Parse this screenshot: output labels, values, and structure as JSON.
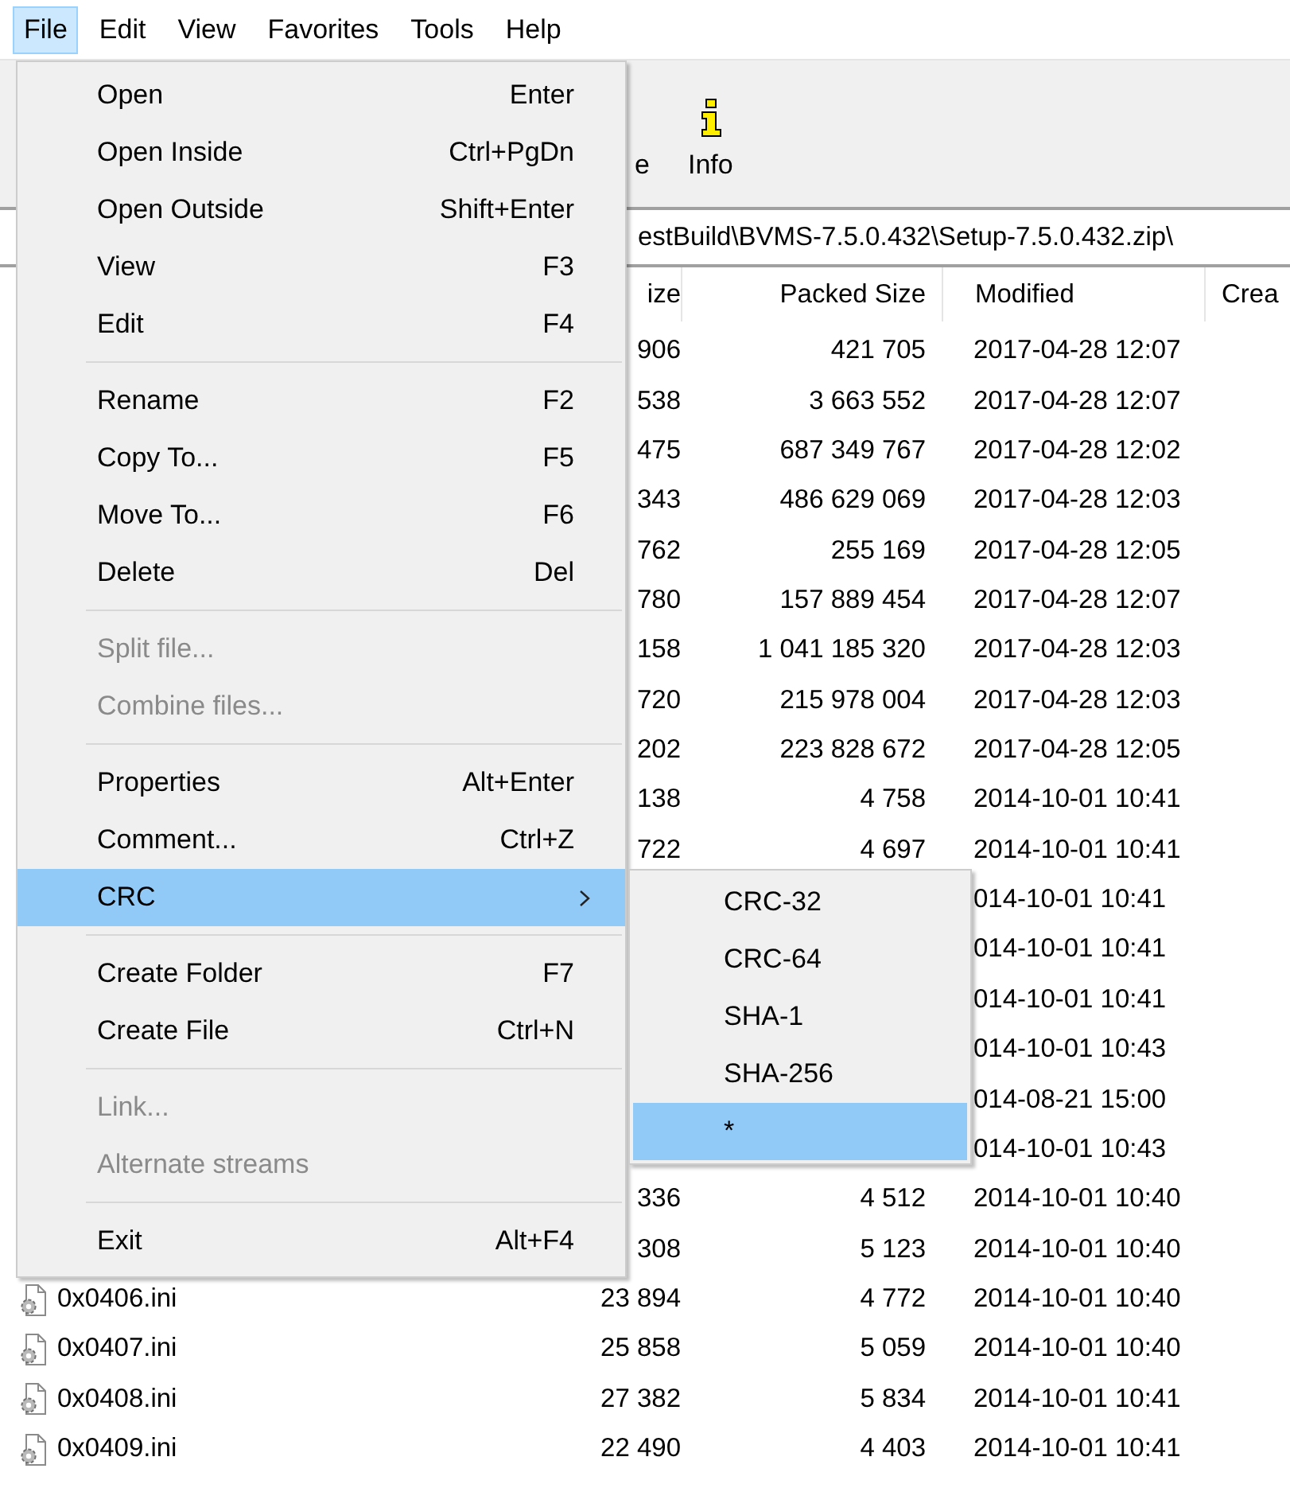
{
  "menubar": [
    {
      "label": "File",
      "selected": true
    },
    {
      "label": "Edit",
      "selected": false
    },
    {
      "label": "View",
      "selected": false
    },
    {
      "label": "Favorites",
      "selected": false
    },
    {
      "label": "Tools",
      "selected": false
    },
    {
      "label": "Help",
      "selected": false
    }
  ],
  "toolbar": [
    {
      "label": "e",
      "kind": "text"
    },
    {
      "label": "Info",
      "kind": "info"
    }
  ],
  "address": "estBuild\\BVMS-7.5.0.432\\Setup-7.5.0.432.zip\\",
  "table": {
    "columns": [
      "ize",
      "Packed Size",
      "Modified",
      "Crea"
    ],
    "rows": [
      {
        "size": "906",
        "packed_size": "421 705",
        "modified": "2017-04-28 12:07"
      },
      {
        "size": "538",
        "packed_size": "3 663 552",
        "modified": "2017-04-28 12:07"
      },
      {
        "size": "475",
        "packed_size": "687 349 767",
        "modified": "2017-04-28 12:02"
      },
      {
        "size": "343",
        "packed_size": "486 629 069",
        "modified": "2017-04-28 12:03"
      },
      {
        "size": "762",
        "packed_size": "255 169",
        "modified": "2017-04-28 12:05"
      },
      {
        "size": "780",
        "packed_size": "157 889 454",
        "modified": "2017-04-28 12:07"
      },
      {
        "size": "158",
        "packed_size": "1 041 185 320",
        "modified": "2017-04-28 12:03"
      },
      {
        "size": "720",
        "packed_size": "215 978 004",
        "modified": "2017-04-28 12:03"
      },
      {
        "size": "202",
        "packed_size": "223 828 672",
        "modified": "2017-04-28 12:05"
      },
      {
        "size": "138",
        "packed_size": "4 758",
        "modified": "2014-10-01 10:41"
      },
      {
        "size": "722",
        "packed_size": "4 697",
        "modified": "2014-10-01 10:41"
      },
      {
        "modified": "014-10-01 10:41"
      },
      {
        "modified": "014-10-01 10:41"
      },
      {
        "modified": "014-10-01 10:41"
      },
      {
        "modified": "014-10-01 10:43"
      },
      {
        "modified": "014-08-21 15:00"
      },
      {
        "modified": "014-10-01 10:43"
      },
      {
        "size": "336",
        "packed_size": "4 512",
        "modified": "2014-10-01 10:40"
      },
      {
        "size": "308",
        "packed_size": "5 123",
        "modified": "2014-10-01 10:40"
      },
      {
        "name": "0x0406.ini",
        "size": "23 894",
        "packed_size": "4 772",
        "modified": "2014-10-01 10:40"
      },
      {
        "name": "0x0407.ini",
        "size": "25 858",
        "packed_size": "5 059",
        "modified": "2014-10-01 10:40"
      },
      {
        "name": "0x0408.ini",
        "size": "27 382",
        "packed_size": "5 834",
        "modified": "2014-10-01 10:41"
      },
      {
        "name": "0x0409.ini",
        "size": "22 490",
        "packed_size": "4 403",
        "modified": "2014-10-01 10:41"
      }
    ]
  },
  "menu": {
    "groups": [
      {
        "items": [
          {
            "label": "Open",
            "shortcut": "Enter",
            "kind": "command",
            "disabled": false,
            "selected": false
          },
          {
            "label": "Open Inside",
            "shortcut": "Ctrl+PgDn",
            "kind": "command",
            "disabled": false,
            "selected": false
          },
          {
            "label": "Open Outside",
            "shortcut": "Shift+Enter",
            "kind": "command",
            "disabled": false,
            "selected": false
          },
          {
            "label": "View",
            "shortcut": "F3",
            "kind": "command",
            "disabled": false,
            "selected": false
          },
          {
            "label": "Edit",
            "shortcut": "F4",
            "kind": "command",
            "disabled": false,
            "selected": false
          }
        ]
      },
      {
        "items": [
          {
            "label": "Rename",
            "shortcut": "F2",
            "kind": "command",
            "disabled": false,
            "selected": false
          },
          {
            "label": "Copy To...",
            "shortcut": "F5",
            "kind": "command",
            "disabled": false,
            "selected": false
          },
          {
            "label": "Move To...",
            "shortcut": "F6",
            "kind": "command",
            "disabled": false,
            "selected": false
          },
          {
            "label": "Delete",
            "shortcut": "Del",
            "kind": "command",
            "disabled": false,
            "selected": false
          }
        ]
      },
      {
        "items": [
          {
            "label": "Split file...",
            "kind": "command",
            "disabled": true,
            "selected": false
          },
          {
            "label": "Combine files...",
            "kind": "command",
            "disabled": true,
            "selected": false
          }
        ]
      },
      {
        "items": [
          {
            "label": "Properties",
            "shortcut": "Alt+Enter",
            "kind": "command",
            "disabled": false,
            "selected": false
          },
          {
            "label": "Comment...",
            "shortcut": "Ctrl+Z",
            "kind": "command",
            "disabled": false,
            "selected": false
          },
          {
            "label": "CRC",
            "kind": "submenu",
            "disabled": false,
            "selected": true
          }
        ]
      },
      {
        "items": [
          {
            "label": "Create Folder",
            "shortcut": "F7",
            "kind": "command",
            "disabled": false,
            "selected": false
          },
          {
            "label": "Create File",
            "shortcut": "Ctrl+N",
            "kind": "command",
            "disabled": false,
            "selected": false
          }
        ]
      },
      {
        "items": [
          {
            "label": "Link...",
            "kind": "command",
            "disabled": true,
            "selected": false
          },
          {
            "label": "Alternate streams",
            "kind": "command",
            "disabled": true,
            "selected": false
          }
        ]
      },
      {
        "items": [
          {
            "label": "Exit",
            "shortcut": "Alt+F4",
            "kind": "command",
            "disabled": false,
            "selected": false
          }
        ]
      }
    ]
  },
  "submenu": {
    "items": [
      {
        "label": "CRC-32",
        "selected": false
      },
      {
        "label": "CRC-64",
        "selected": false
      },
      {
        "label": "SHA-1",
        "selected": false
      },
      {
        "label": "SHA-256",
        "selected": false
      },
      {
        "label": "*",
        "selected": true
      }
    ]
  }
}
